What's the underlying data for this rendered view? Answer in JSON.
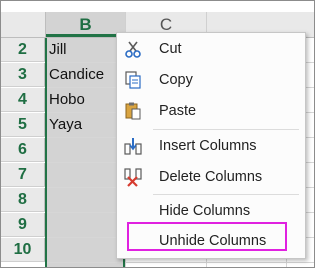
{
  "columns": [
    {
      "label": "B",
      "selected": true
    },
    {
      "label": "C",
      "selected": false
    }
  ],
  "rows": [
    {
      "num": "2",
      "b": "Jill"
    },
    {
      "num": "3",
      "b": "Candice"
    },
    {
      "num": "4",
      "b": "Hobo"
    },
    {
      "num": "5",
      "b": "Yaya"
    },
    {
      "num": "6",
      "b": ""
    },
    {
      "num": "7",
      "b": ""
    },
    {
      "num": "8",
      "b": ""
    },
    {
      "num": "9",
      "b": ""
    },
    {
      "num": "10",
      "b": ""
    }
  ],
  "menu": {
    "cut": "Cut",
    "copy": "Copy",
    "paste": "Paste",
    "insert_columns": "Insert Columns",
    "delete_columns": "Delete Columns",
    "hide_columns": "Hide Columns",
    "unhide_columns": "Unhide Columns"
  },
  "colors": {
    "selection_green": "#217346",
    "highlight_magenta": "#e021e0",
    "selected_column_fill": "#d3d3d3"
  }
}
